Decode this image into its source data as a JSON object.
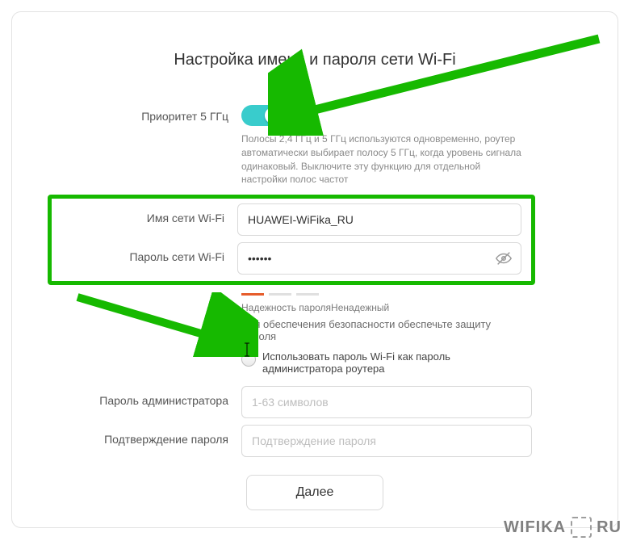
{
  "title": "Настройка имени и пароля сети Wi-Fi",
  "priority": {
    "label": "Приоритет 5 ГГц",
    "help": "Полосы 2,4 ГГц и 5 ГГц используются одновременно, роутер автоматически выбирает полосу 5 ГГц, когда уровень сигнала одинаковый. Выключите эту функцию для отдельной настройки полос частот"
  },
  "wifi_name": {
    "label": "Имя сети Wi-Fi",
    "value": "HUAWEI-WiFika_RU"
  },
  "wifi_password": {
    "label": "Пароль сети Wi-Fi",
    "value": "••••••"
  },
  "strength": {
    "label_prefix": "Надежность пароля",
    "value": "Ненадежный"
  },
  "note": "Для обеспечения безопасности обеспечьте защиту пароля",
  "use_as_admin": "Использовать пароль Wi-Fi как пароль администратора роутера",
  "admin_password": {
    "label": "Пароль администратора",
    "placeholder": "1-63 символов"
  },
  "confirm_password": {
    "label": "Подтверждение пароля",
    "placeholder": "Подтверждение пароля"
  },
  "next": "Далее",
  "watermark": {
    "a": "WIFIKA",
    "b": "RU"
  }
}
